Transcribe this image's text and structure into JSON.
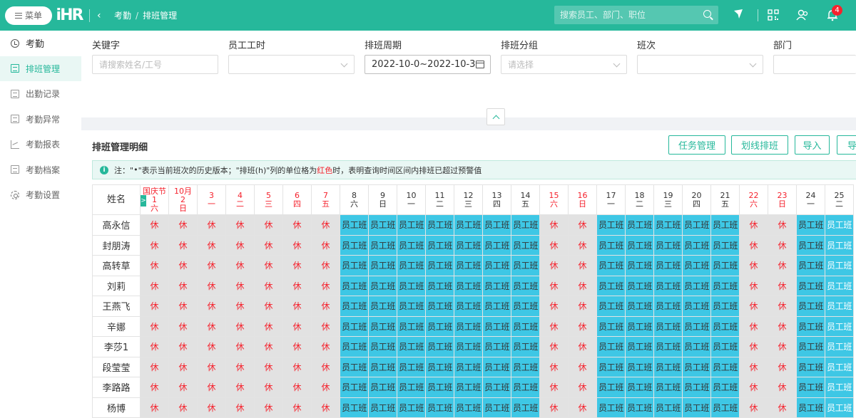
{
  "topbar": {
    "menu_label": "菜单",
    "logo_text": "iHR",
    "breadcrumb": [
      "考勤",
      "排班管理"
    ],
    "breadcrumb_sep": "/",
    "search_placeholder": "搜索员工、部门、职位",
    "notification_count": "4"
  },
  "sidebar": {
    "items": [
      {
        "label": "考勤",
        "icon": "clock-icon"
      },
      {
        "label": "排班管理",
        "icon": "schedule-icon"
      },
      {
        "label": "出勤记录",
        "icon": "record-icon"
      },
      {
        "label": "考勤异常",
        "icon": "exception-icon"
      },
      {
        "label": "考勤报表",
        "icon": "chart-icon"
      },
      {
        "label": "考勤档案",
        "icon": "archive-icon"
      },
      {
        "label": "考勤设置",
        "icon": "gear-icon"
      }
    ]
  },
  "filters": {
    "keyword_label": "关键字",
    "keyword_placeholder": "请搜索姓名/工号",
    "hours_label": "员工工时",
    "period_label": "排班周期",
    "period_value": "2022-10-0~2022-10-3",
    "group_label": "排班分组",
    "group_placeholder": "请选择",
    "shift_label": "班次",
    "dept_label": "部门"
  },
  "detail": {
    "title": "排班管理明细",
    "buttons": [
      "任务管理",
      "划线排班",
      "导入",
      "导"
    ],
    "notice_prefix": "注：\"",
    "notice_dot": "•",
    "notice_mid": "\"表示当前班次的历史版本；\"排班(h)\"列的单位格为",
    "notice_red": "红色",
    "notice_suffix": "时，表明查询时间区间内排班已超过预警值"
  },
  "grid": {
    "name_header": "姓名",
    "days": [
      {
        "top": "国庆节",
        "mid": "1",
        "bot": "六",
        "hol": true
      },
      {
        "top": "10月",
        "mid": "2",
        "bot": "日",
        "hol": true
      },
      {
        "top": "",
        "mid": "3",
        "bot": "一",
        "hol": true
      },
      {
        "top": "",
        "mid": "4",
        "bot": "二",
        "hol": true
      },
      {
        "top": "",
        "mid": "5",
        "bot": "三",
        "hol": true
      },
      {
        "top": "",
        "mid": "6",
        "bot": "四",
        "hol": true
      },
      {
        "top": "",
        "mid": "7",
        "bot": "五",
        "hol": true
      },
      {
        "top": "",
        "mid": "8",
        "bot": "六",
        "hol": false
      },
      {
        "top": "",
        "mid": "9",
        "bot": "日",
        "hol": false
      },
      {
        "top": "",
        "mid": "10",
        "bot": "一",
        "hol": false
      },
      {
        "top": "",
        "mid": "11",
        "bot": "二",
        "hol": false
      },
      {
        "top": "",
        "mid": "12",
        "bot": "三",
        "hol": false
      },
      {
        "top": "",
        "mid": "13",
        "bot": "四",
        "hol": false
      },
      {
        "top": "",
        "mid": "14",
        "bot": "五",
        "hol": false
      },
      {
        "top": "",
        "mid": "15",
        "bot": "六",
        "hol": true
      },
      {
        "top": "",
        "mid": "16",
        "bot": "日",
        "hol": true
      },
      {
        "top": "",
        "mid": "17",
        "bot": "一",
        "hol": false
      },
      {
        "top": "",
        "mid": "18",
        "bot": "二",
        "hol": false
      },
      {
        "top": "",
        "mid": "19",
        "bot": "三",
        "hol": false
      },
      {
        "top": "",
        "mid": "20",
        "bot": "四",
        "hol": false
      },
      {
        "top": "",
        "mid": "21",
        "bot": "五",
        "hol": false
      },
      {
        "top": "",
        "mid": "22",
        "bot": "六",
        "hol": true
      },
      {
        "top": "",
        "mid": "23",
        "bot": "日",
        "hol": true
      },
      {
        "top": "",
        "mid": "24",
        "bot": "一",
        "hol": false
      },
      {
        "top": "",
        "mid": "25",
        "bot": "二",
        "hol": false
      }
    ],
    "employees": [
      "高永信",
      "封朋涛",
      "高转草",
      "刘莉",
      "王燕飞",
      "辛娜",
      "李莎1",
      "段莹莹",
      "李路路",
      "杨博"
    ],
    "rest_label": "休",
    "work_label": "员工班",
    "pattern": [
      "R",
      "R",
      "R",
      "R",
      "R",
      "R",
      "R",
      "W",
      "W",
      "W",
      "W",
      "W",
      "W",
      "W",
      "R",
      "R",
      "W",
      "W",
      "W",
      "W",
      "W",
      "R",
      "R",
      "W",
      "W"
    ]
  },
  "colors": {
    "brand": "#26b89b",
    "work_cell": "#3ec7e5",
    "rest_cell": "#e2e2e2",
    "holiday_text": "#f5222d"
  }
}
